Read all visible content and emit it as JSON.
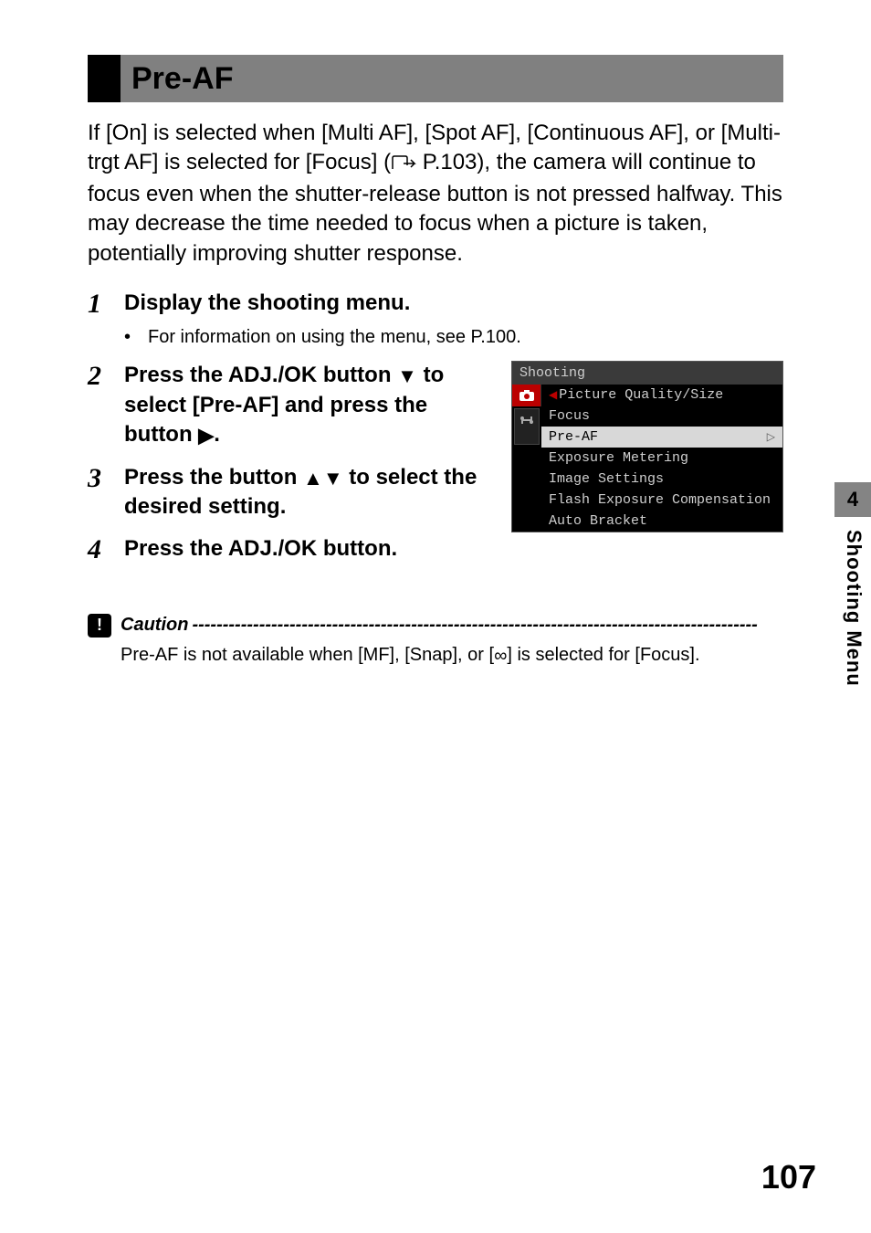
{
  "heading": "Pre-AF",
  "intro": {
    "part1": "If [On] is selected when [Multi AF], [Spot AF], [Continuous AF], or [Multi-trgt AF] is selected for [Focus] (",
    "ref": "P.103",
    "part2": "), the camera will continue to focus even when the shutter-release button is not pressed halfway. This may decrease the time needed to focus when a picture is taken, potentially improving shutter response."
  },
  "steps": [
    {
      "num": "1",
      "title": "Display the shooting menu.",
      "sub": "For information on using the menu, see P.100."
    },
    {
      "num": "2",
      "title_a": "Press the ADJ./OK button ",
      "title_b": " to select [Pre-AF] and press the button ",
      "title_c": "."
    },
    {
      "num": "3",
      "title_a": "Press the button ",
      "title_b": " to select the desired setting."
    },
    {
      "num": "4",
      "title": "Press the ADJ./OK button."
    }
  ],
  "lcd": {
    "title": "Shooting",
    "items": [
      "Picture Quality/Size",
      "Focus",
      "Pre-AF",
      "Exposure Metering",
      "Image Settings",
      "Flash Exposure Compensation",
      "Auto Bracket"
    ],
    "selected_index": 2
  },
  "caution": {
    "label": "Caution",
    "text_a": "Pre-AF is not available when [MF], [Snap], or [",
    "text_b": "] is selected for [Focus]."
  },
  "side": {
    "chapter": "4",
    "label": "Shooting Menu"
  },
  "page_number": "107"
}
